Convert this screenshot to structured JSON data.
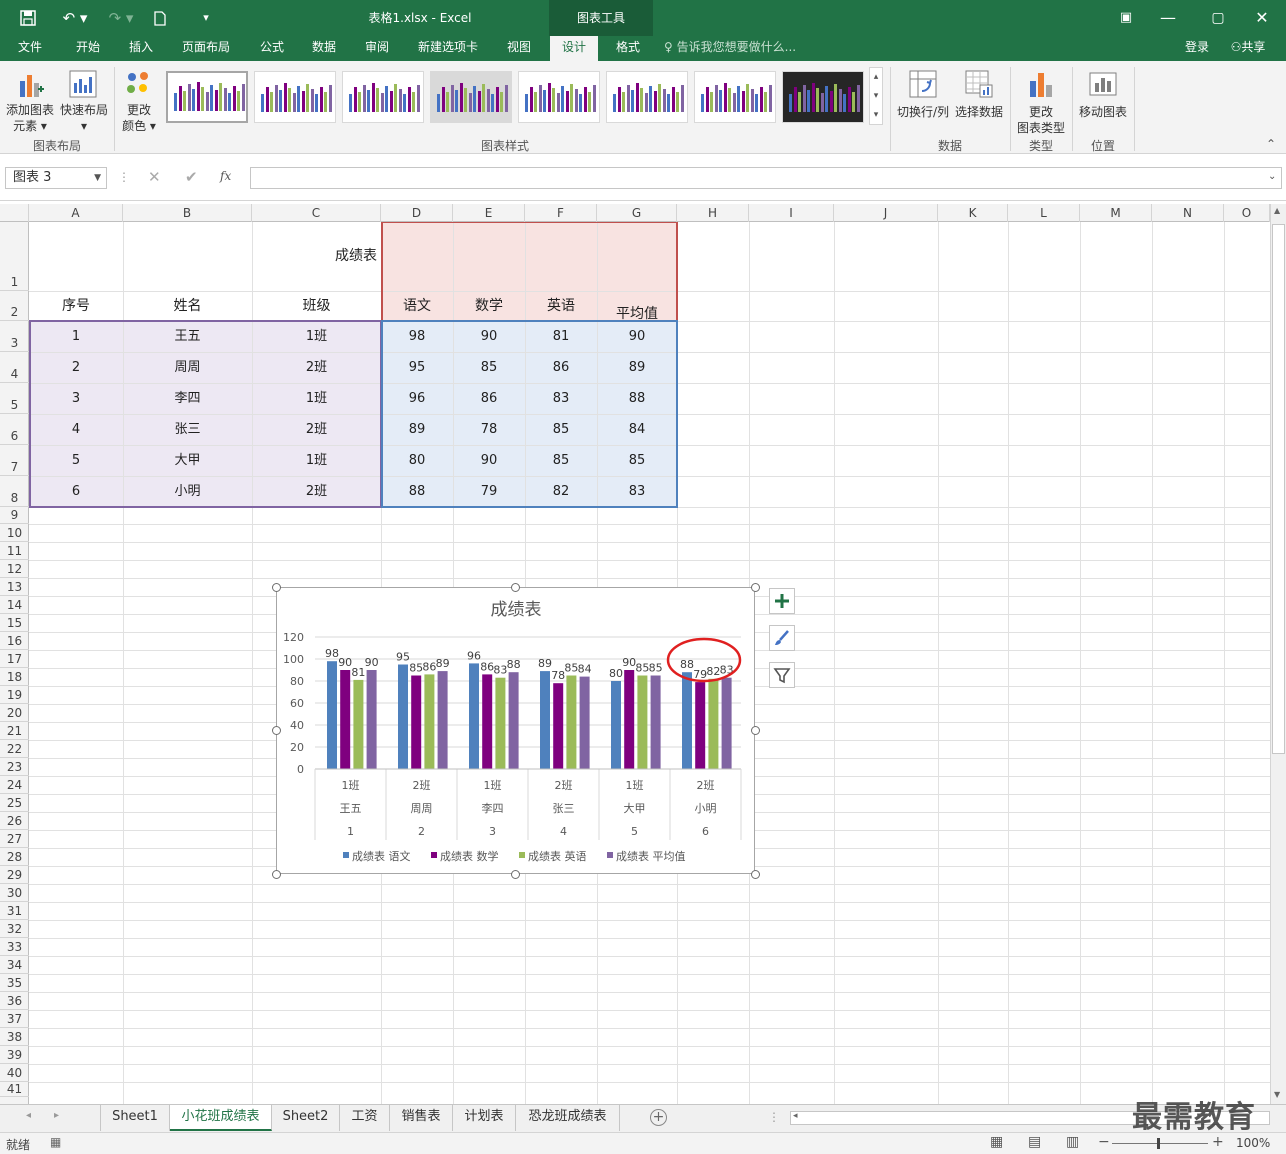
{
  "window": {
    "doc_title": "表格1.xlsx - Excel",
    "context_group": "图表工具",
    "login": "登录",
    "share": "共享"
  },
  "menu": [
    "文件",
    "开始",
    "插入",
    "页面布局",
    "公式",
    "数据",
    "审阅",
    "新建选项卡",
    "视图",
    "设计",
    "格式"
  ],
  "menu_active": "设计",
  "tellme": "告诉我您想要做什么...",
  "ribbon": {
    "add_element_1": "添加图表",
    "add_element_2": "元素",
    "quick_layout": "快速布局",
    "change_color_1": "更改",
    "change_color_2": "颜色",
    "group_layout": "图表布局",
    "group_styles": "图表样式",
    "switch_rowcol": "切换行/列",
    "select_data": "选择数据",
    "group_data": "数据",
    "change_type_1": "更改",
    "change_type_2": "图表类型",
    "group_type": "类型",
    "move_chart": "移动图表",
    "group_location": "位置"
  },
  "formula_bar": {
    "name_box": "图表 3",
    "fx": "fx",
    "formula": ""
  },
  "columns": [
    "A",
    "B",
    "C",
    "D",
    "E",
    "F",
    "G",
    "H",
    "I",
    "J",
    "K",
    "L",
    "M",
    "N",
    "O"
  ],
  "rows": [
    "1",
    "2",
    "3",
    "4",
    "5",
    "6",
    "7",
    "8",
    "9",
    "10",
    "11",
    "12",
    "13",
    "14",
    "15",
    "16",
    "17",
    "18",
    "19",
    "20",
    "21",
    "22",
    "23",
    "24",
    "25",
    "26",
    "27",
    "28",
    "29",
    "30",
    "31",
    "32",
    "33",
    "34",
    "35",
    "36",
    "37",
    "38",
    "39",
    "40",
    "41"
  ],
  "table": {
    "title": "成绩表",
    "headers": [
      "序号",
      "姓名",
      "班级",
      "语文",
      "数学",
      "英语",
      "平均值"
    ],
    "rows": [
      [
        "1",
        "王五",
        "1班",
        "98",
        "90",
        "81",
        "90"
      ],
      [
        "2",
        "周周",
        "2班",
        "95",
        "85",
        "86",
        "89"
      ],
      [
        "3",
        "李四",
        "1班",
        "96",
        "86",
        "83",
        "88"
      ],
      [
        "4",
        "张三",
        "2班",
        "89",
        "78",
        "85",
        "84"
      ],
      [
        "5",
        "大甲",
        "1班",
        "80",
        "90",
        "85",
        "85"
      ],
      [
        "6",
        "小明",
        "2班",
        "88",
        "79",
        "82",
        "83"
      ]
    ]
  },
  "chart_data": {
    "type": "bar",
    "title": "成绩表",
    "categories": [
      {
        "class": "1班",
        "name": "王五",
        "id": "1"
      },
      {
        "class": "2班",
        "name": "周周",
        "id": "2"
      },
      {
        "class": "1班",
        "name": "李四",
        "id": "3"
      },
      {
        "class": "2班",
        "name": "张三",
        "id": "4"
      },
      {
        "class": "1班",
        "name": "大甲",
        "id": "5"
      },
      {
        "class": "2班",
        "name": "小明",
        "id": "6"
      }
    ],
    "series": [
      {
        "name": "成绩表 语文",
        "color": "#4f81bd",
        "values": [
          98,
          95,
          96,
          89,
          80,
          88
        ]
      },
      {
        "name": "成绩表 数学",
        "color": "#7f007f",
        "values": [
          90,
          85,
          86,
          78,
          90,
          79
        ]
      },
      {
        "name": "成绩表 英语",
        "color": "#9bbb59",
        "values": [
          81,
          86,
          83,
          85,
          85,
          82
        ]
      },
      {
        "name": "成绩表 平均值",
        "color": "#8064a2",
        "values": [
          90,
          89,
          88,
          84,
          85,
          83
        ]
      }
    ],
    "ylim": [
      0,
      120
    ],
    "yticks": [
      "0",
      "20",
      "40",
      "60",
      "80",
      "100",
      "120"
    ],
    "legend": "bottom",
    "grid": true
  },
  "sheet_tabs": [
    "Sheet1",
    "小花班成绩表",
    "Sheet2",
    "工资",
    "销售表",
    "计划表",
    "恐龙班成绩表"
  ],
  "sheet_active": "小花班成绩表",
  "status": {
    "ready": "就绪",
    "zoom": "100%"
  },
  "watermark": "最需教育"
}
